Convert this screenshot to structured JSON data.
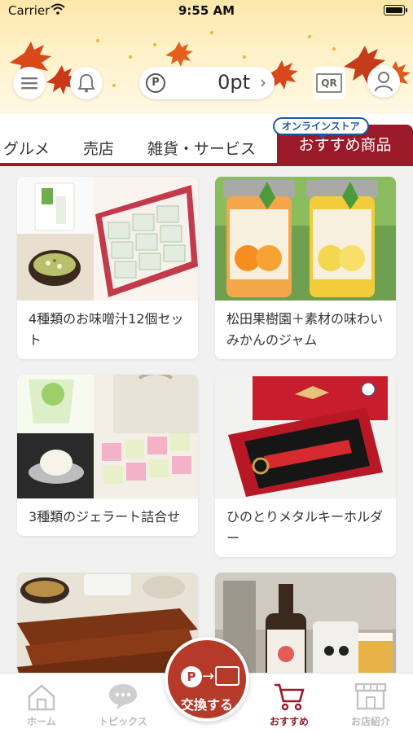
{
  "status_bar": {
    "carrier": "Carrier",
    "time": "9:55 AM"
  },
  "header": {
    "points_value": "0pt",
    "qr_label": "QR"
  },
  "tabs": {
    "items": [
      {
        "label": "グルメ"
      },
      {
        "label": "売店"
      },
      {
        "label": "雑貨・サービス"
      }
    ],
    "active_label": "おすすめ商品",
    "active_badge": "オンラインストア"
  },
  "products": [
    {
      "title": "4種類のお味噌汁12個セット"
    },
    {
      "title": "松田果樹園＋素材の味わい みかんのジャム"
    },
    {
      "title": "3種類のジェラート詰合せ"
    },
    {
      "title": "ひのとりメタルキーホルダー"
    }
  ],
  "bottom_nav": {
    "home": "ホーム",
    "topics": "トピックス",
    "exchange": "交換する",
    "recommended": "おすすめ",
    "shops": "お店紹介"
  },
  "colors": {
    "brand": "#9a1a2a",
    "exchange": "#b53a2a",
    "badge_blue": "#1e5aa0"
  }
}
